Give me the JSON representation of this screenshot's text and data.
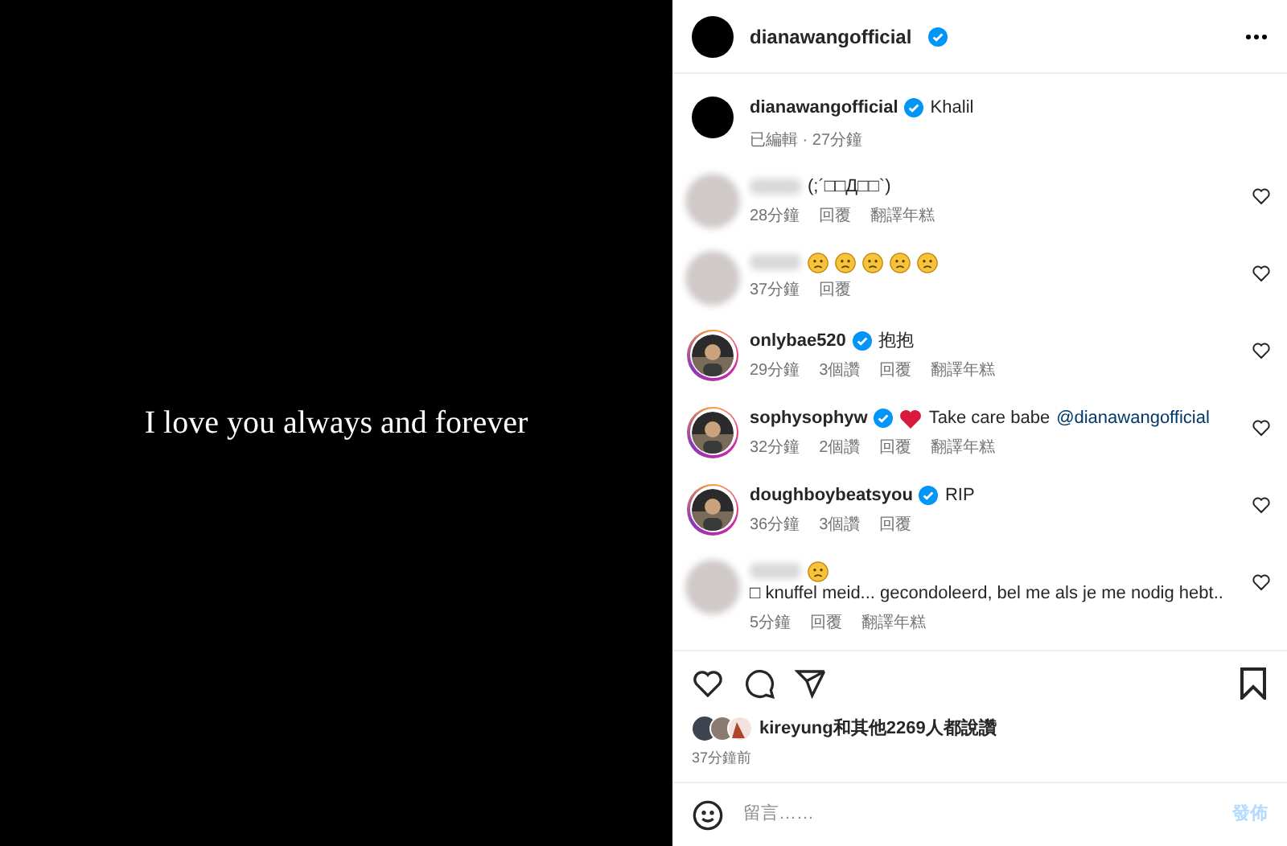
{
  "media": {
    "caption": "I love you always and forever"
  },
  "header": {
    "username": "dianawangofficial",
    "verified": true
  },
  "caption": {
    "username": "dianawangofficial",
    "verified": true,
    "text": "Khalil",
    "meta": "已編輯 · 27分鐘"
  },
  "comments": [
    {
      "avatar": {
        "kind": "blurred",
        "story_ring": false
      },
      "verified": false,
      "body": [
        {
          "kind": "text",
          "text": "(;´□□Д□□`)"
        }
      ],
      "time": "28分鐘",
      "actions": [
        "回覆",
        "翻譯年糕"
      ]
    },
    {
      "avatar": {
        "kind": "blurred",
        "story_ring": false
      },
      "verified": false,
      "body": [
        {
          "kind": "emoji"
        },
        {
          "kind": "emoji"
        },
        {
          "kind": "emoji"
        },
        {
          "kind": "emoji"
        },
        {
          "kind": "emoji"
        }
      ],
      "time": "37分鐘",
      "actions": [
        "回覆"
      ]
    },
    {
      "avatar": {
        "kind": "picture",
        "story_ring": true
      },
      "username": "onlybae520",
      "verified": true,
      "body": [
        {
          "kind": "text",
          "text": "抱抱"
        }
      ],
      "time": "29分鐘",
      "actions": [
        "3個讚",
        "回覆",
        "翻譯年糕"
      ]
    },
    {
      "avatar": {
        "kind": "picture",
        "story_ring": true
      },
      "username": "sophysophyw",
      "verified": true,
      "body": [
        {
          "kind": "heart"
        },
        {
          "kind": "text",
          "text": "Take care babe"
        },
        {
          "kind": "mention",
          "text": "@dianawangofficial"
        }
      ],
      "time": "32分鐘",
      "actions": [
        "2個讚",
        "回覆",
        "翻譯年糕"
      ]
    },
    {
      "avatar": {
        "kind": "picture",
        "story_ring": true
      },
      "username": "doughboybeatsyou",
      "verified": true,
      "body": [
        {
          "kind": "text",
          "text": "RIP"
        }
      ],
      "time": "36分鐘",
      "actions": [
        "3個讚",
        "回覆"
      ]
    },
    {
      "avatar": {
        "kind": "blurred",
        "story_ring": false
      },
      "verified": false,
      "body": [
        {
          "kind": "emoji"
        },
        {
          "kind": "text",
          "text": "□ knuffel meid... gecondoleerd, bel me als je me nodig hebt.."
        }
      ],
      "time": "5分鐘",
      "actions": [
        "回覆",
        "翻譯年糕"
      ]
    }
  ],
  "likes": {
    "text": "kireyung和其他2269人都說讚",
    "time": "37分鐘前"
  },
  "composer": {
    "placeholder": "留言……",
    "post": "發佈",
    "post_disabled": true
  }
}
